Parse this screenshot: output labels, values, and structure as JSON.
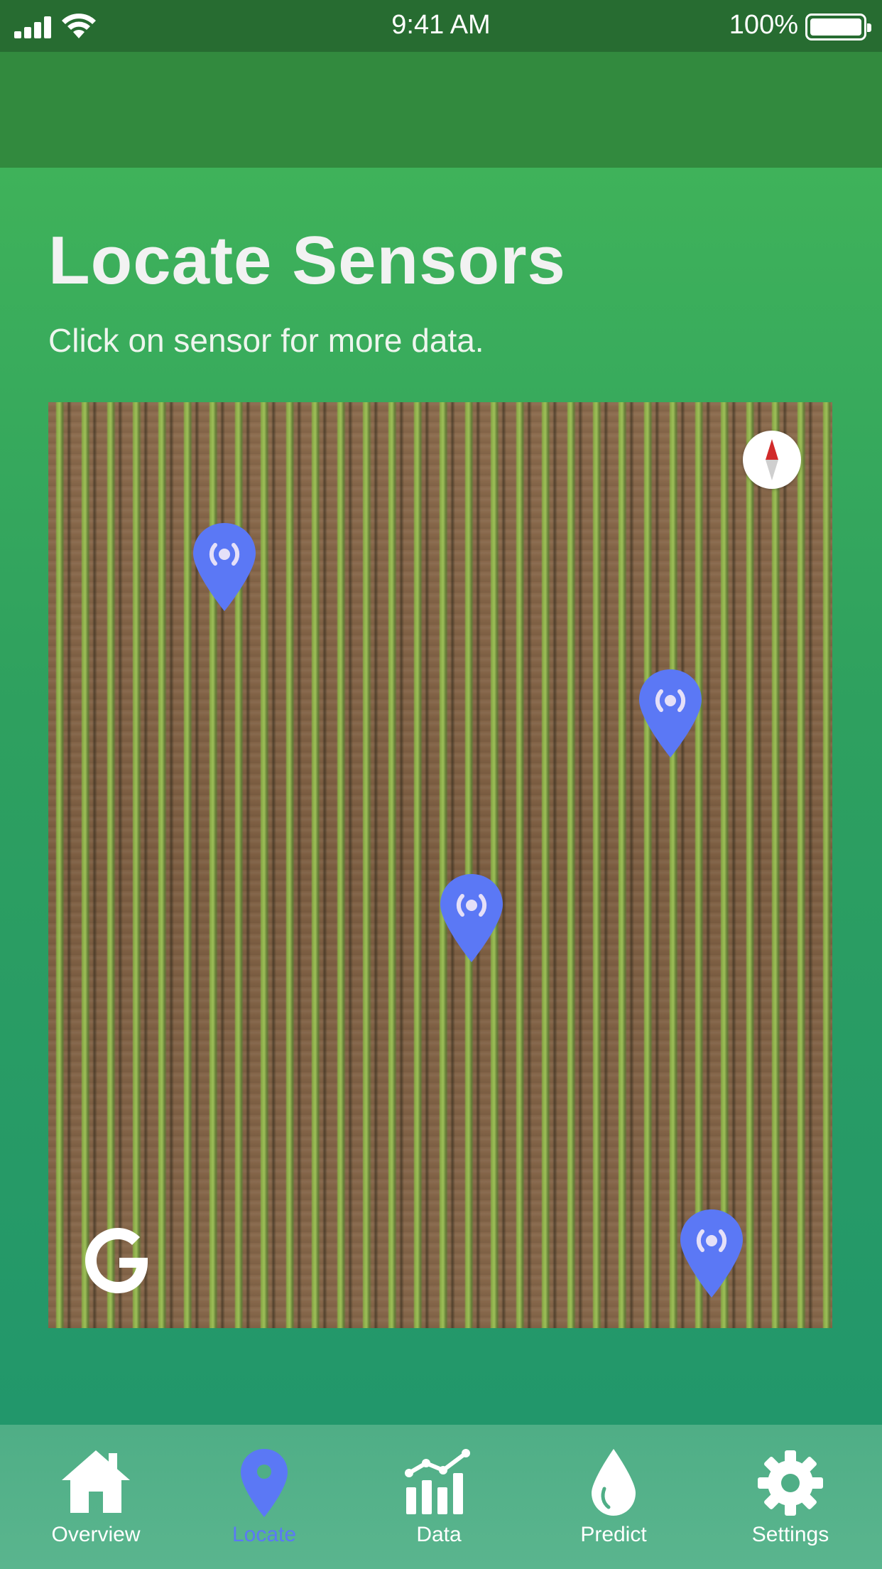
{
  "status_bar": {
    "time": "9:41 AM",
    "battery_percent": "100%"
  },
  "page": {
    "title": "Locate Sensors",
    "subtitle": "Click on sensor for more data."
  },
  "map": {
    "type": "satellite",
    "sensors": [
      {
        "name": "sensor-1",
        "icon": "sensor-pin-icon"
      },
      {
        "name": "sensor-2",
        "icon": "sensor-pin-icon"
      },
      {
        "name": "sensor-3",
        "icon": "sensor-pin-icon"
      },
      {
        "name": "sensor-4",
        "icon": "sensor-pin-icon"
      }
    ],
    "compass_icon": "compass-icon",
    "logo": "google-logo"
  },
  "tab_bar": {
    "active": "Locate",
    "tabs": [
      {
        "label": "Overview",
        "icon": "home-icon"
      },
      {
        "label": "Locate",
        "icon": "location-pin-icon"
      },
      {
        "label": "Data",
        "icon": "chart-icon"
      },
      {
        "label": "Predict",
        "icon": "droplet-icon"
      },
      {
        "label": "Settings",
        "icon": "gear-icon"
      }
    ]
  },
  "colors": {
    "accent": "#5b78f5",
    "status_bar": "#276c31",
    "nav_bar": "#328a3e",
    "background": "#3fb25a",
    "tab_bar": "#52b08a"
  }
}
